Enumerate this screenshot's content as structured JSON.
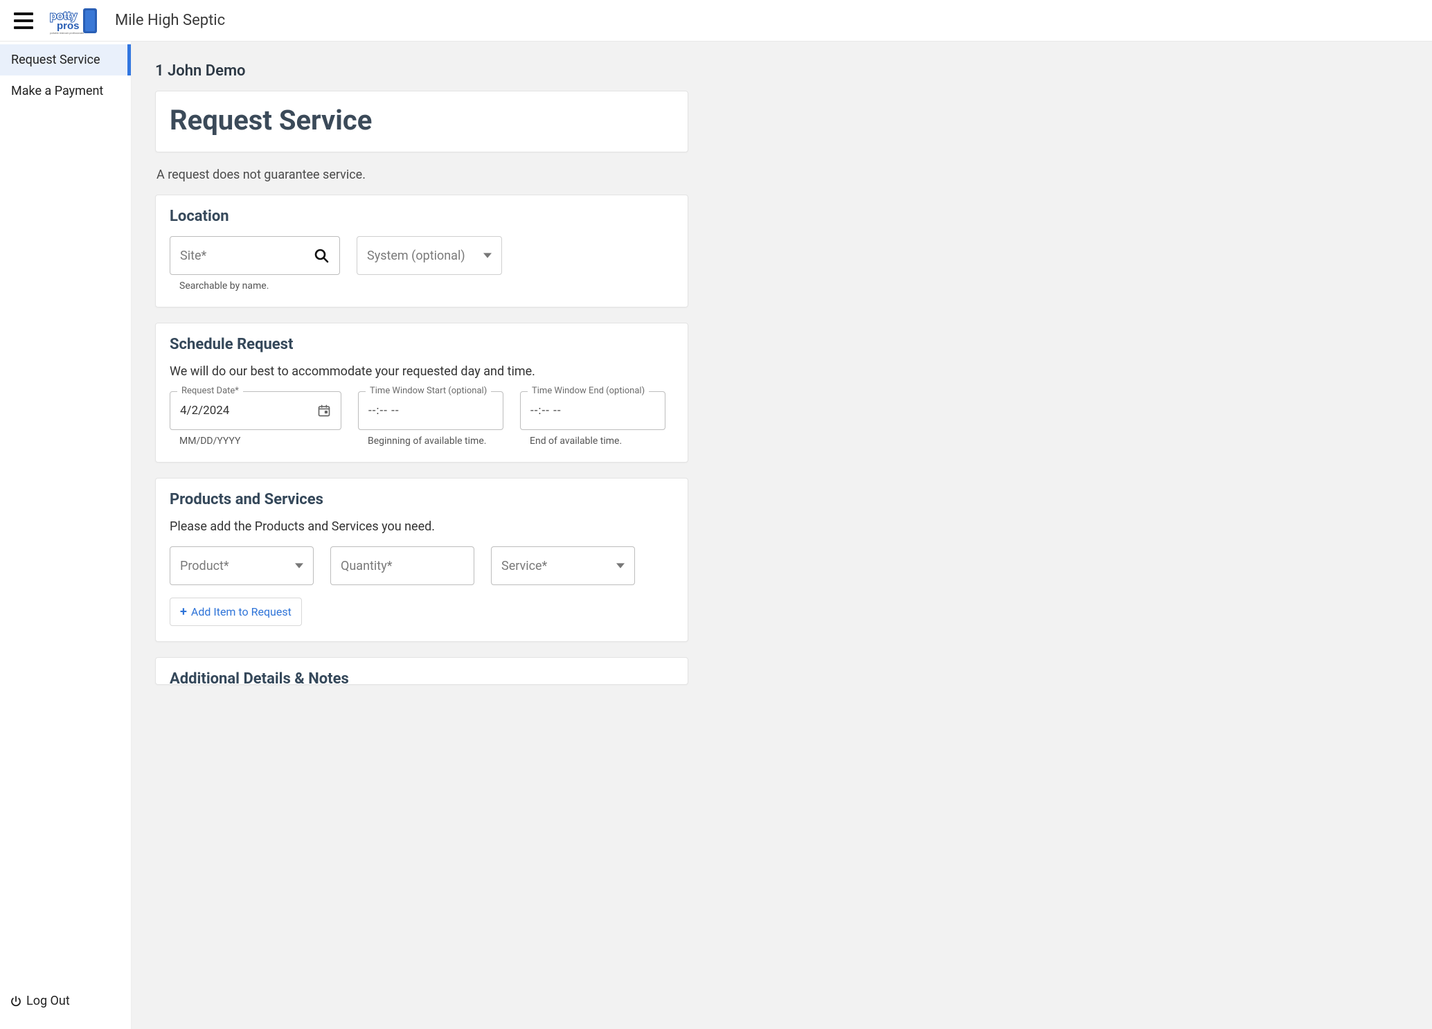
{
  "header": {
    "company_name": "Mile High Septic"
  },
  "sidebar": {
    "items": [
      {
        "label": "Request Service"
      },
      {
        "label": "Make a Payment"
      }
    ],
    "logout_label": "Log Out"
  },
  "main": {
    "account_name": "1 John Demo",
    "page_title": "Request Service",
    "disclaimer": "A request does not guarantee service.",
    "location": {
      "title": "Location",
      "site_label": "Site*",
      "site_helper": "Searchable by name.",
      "system_label": "System (optional)"
    },
    "schedule": {
      "title": "Schedule Request",
      "desc": "We will do our best to accommodate your requested day and time.",
      "date_label": "Request Date*",
      "date_value": "4/2/2024",
      "date_helper": "MM/DD/YYYY",
      "start_label": "Time Window Start (optional)",
      "start_value": "--:--  --",
      "start_helper": "Beginning of available time.",
      "end_label": "Time Window End (optional)",
      "end_value": "--:--  --",
      "end_helper": "End of available time."
    },
    "products": {
      "title": "Products and Services",
      "desc": "Please add the Products and Services you need.",
      "product_label": "Product*",
      "quantity_label": "Quantity*",
      "service_label": "Service*",
      "add_item_label": "Add Item to Request"
    },
    "details": {
      "title": "Additional Details & Notes"
    }
  }
}
